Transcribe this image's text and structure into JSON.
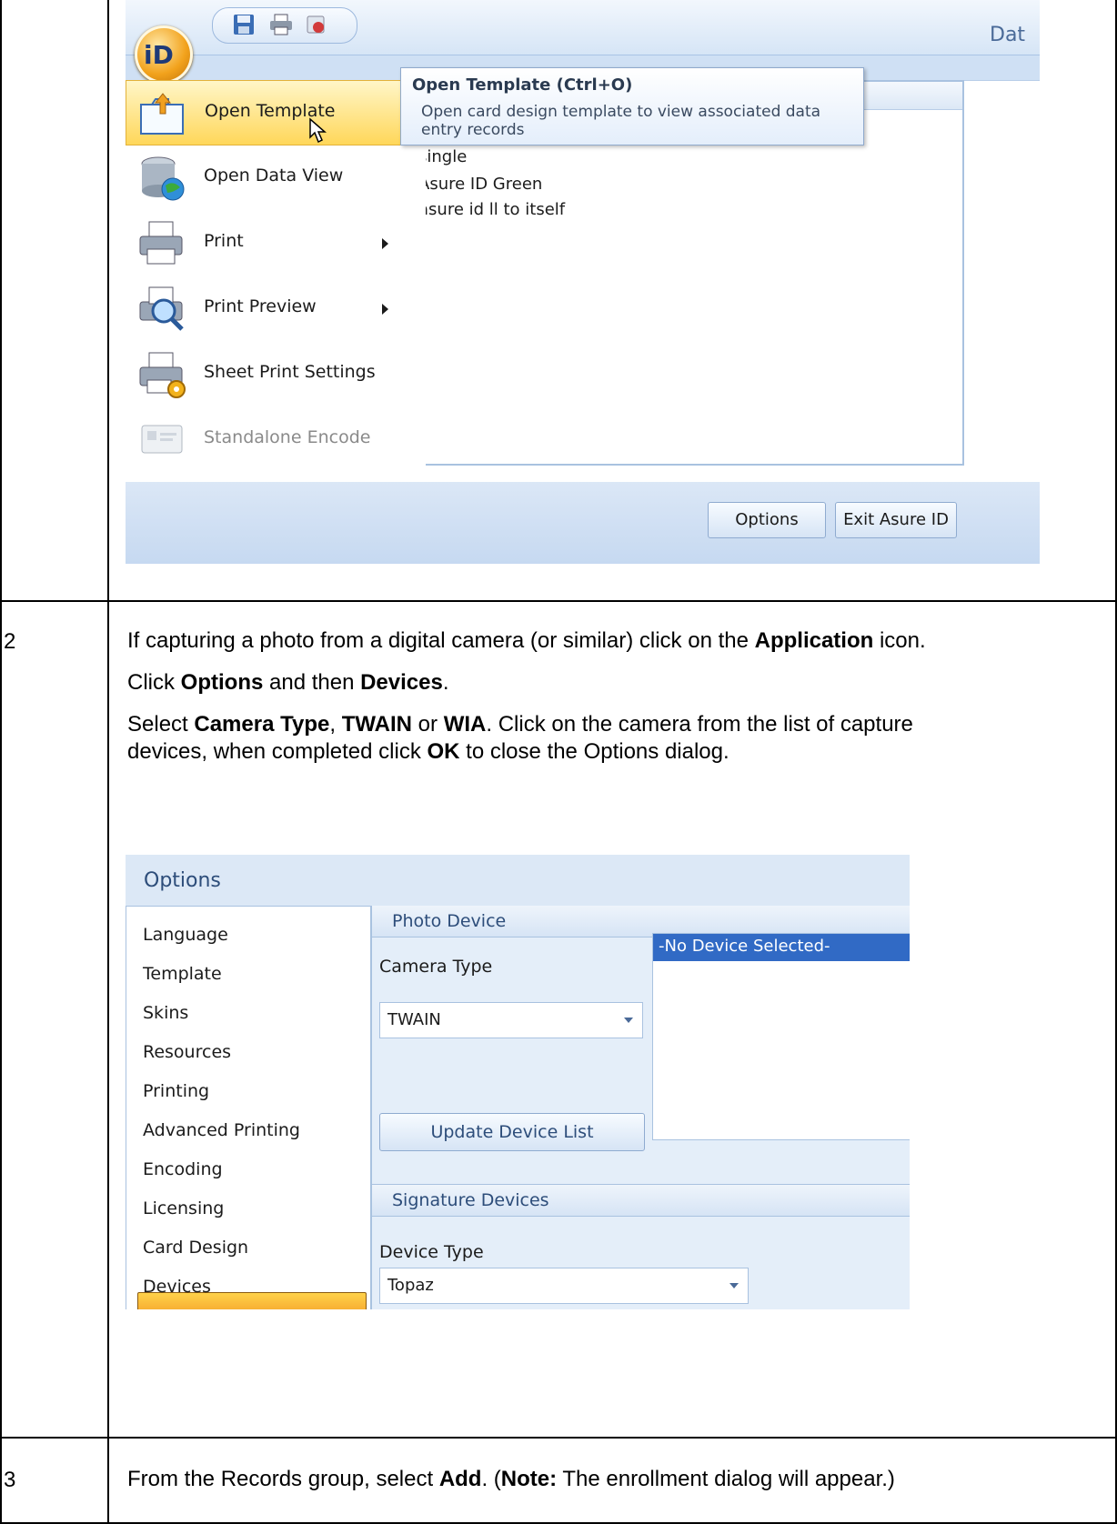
{
  "app_menu": {
    "window_title_partial": "Dat",
    "orb_label": "iD",
    "items": [
      {
        "label": "Open Template",
        "icon": "open-folder-arrow-icon",
        "selected": true,
        "submenu": false,
        "disabled": false
      },
      {
        "label": "Open Data View",
        "icon": "database-globe-icon",
        "selected": false,
        "submenu": false,
        "disabled": false
      },
      {
        "label": "Print",
        "icon": "printer-icon",
        "selected": false,
        "submenu": true,
        "disabled": false
      },
      {
        "label": "Print Preview",
        "icon": "print-preview-magnifier-icon",
        "selected": false,
        "submenu": true,
        "disabled": false
      },
      {
        "label": "Sheet Print Settings",
        "icon": "printer-settings-gear-icon",
        "selected": false,
        "submenu": false,
        "disabled": false
      },
      {
        "label": "Standalone Encode",
        "icon": "encode-card-icon",
        "selected": false,
        "submenu": false,
        "disabled": true
      }
    ],
    "recent_items": [
      "single",
      "Asure ID Green",
      "asure id ll to itself"
    ],
    "tooltip": {
      "title": "Open Template (Ctrl+O)",
      "description": "Open card design template to view associated data entry records"
    },
    "buttons": {
      "options": "Options",
      "exit": "Exit Asure ID"
    }
  },
  "steps": [
    {
      "number": "2",
      "lines": [
        [
          {
            "t": "If capturing a photo from a digital camera (or similar) click on the "
          },
          {
            "t": "Application",
            "b": true
          },
          {
            "t": " icon."
          }
        ],
        [
          {
            "t": "Click "
          },
          {
            "t": "Options",
            "b": true
          },
          {
            "t": " and then "
          },
          {
            "t": "Devices",
            "b": true
          },
          {
            "t": "."
          }
        ],
        [
          {
            "t": "Select "
          },
          {
            "t": "Camera Type",
            "b": true
          },
          {
            "t": ", "
          },
          {
            "t": "TWAIN",
            "b": true
          },
          {
            "t": " or "
          },
          {
            "t": "WIA",
            "b": true
          },
          {
            "t": ". Click on the camera from the list of capture"
          }
        ],
        [
          {
            "t": "devices, when completed click "
          },
          {
            "t": "OK",
            "b": true
          },
          {
            "t": " to close the Options dialog."
          }
        ]
      ]
    },
    {
      "number": "3",
      "lines": [
        [
          {
            "t": "From the Records group, select "
          },
          {
            "t": "Add",
            "b": true
          },
          {
            "t": ". ("
          },
          {
            "t": "Note:",
            "b": true
          },
          {
            "t": "  The enrollment dialog will appear.)"
          }
        ]
      ]
    }
  ],
  "options_dialog": {
    "title": "Options",
    "nav": [
      "Language",
      "Template",
      "Skins",
      "Resources",
      "Printing",
      "Advanced Printing",
      "Encoding",
      "Licensing",
      "Card Design",
      "Devices"
    ],
    "selected_nav": "Devices",
    "photo_device": {
      "header": "Photo Device",
      "camera_type_label": "Camera Type",
      "camera_type_value": "TWAIN",
      "device_list_selected": "-No Device Selected-",
      "update_button": "Update Device List"
    },
    "signature_devices": {
      "header": "Signature Devices",
      "device_type_label": "Device Type",
      "device_type_value": "Topaz"
    }
  }
}
